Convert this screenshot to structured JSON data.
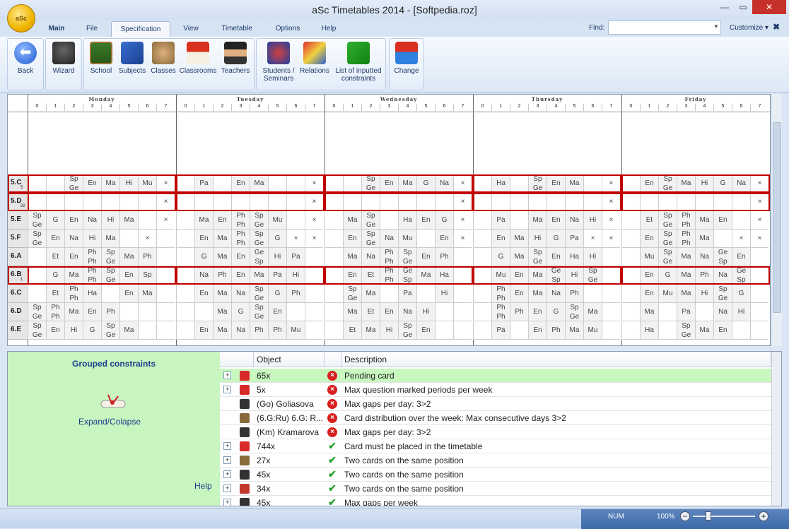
{
  "window": {
    "title": "aSc Timetables 2014  - [Softpedia.roz]",
    "minimize": "—",
    "maximize": "▭",
    "close": "✕",
    "orb": "aSc"
  },
  "tabs": [
    "Main",
    "File",
    "Specification",
    "View",
    "Timetable",
    "Options",
    "Help"
  ],
  "find": {
    "label": "Find:",
    "value": ""
  },
  "customize": "Customize ▾",
  "close_x": "✖",
  "ribbon": {
    "back": "Back",
    "wizard": "Wizard",
    "school": "School",
    "subjects": "Subjects",
    "classes": "Classes",
    "classrooms": "Classrooms",
    "teachers": "Teachers",
    "students_1": "Students /",
    "students_2": "Seminars",
    "relations": "Relations",
    "list_1": "List of inputted",
    "list_2": "constraints",
    "change": "Change"
  },
  "days": [
    "Monday",
    "Tuesday",
    "Wednesday",
    "Thursday",
    "Friday"
  ],
  "periods": [
    "0",
    "1",
    "2",
    "3",
    "4",
    "5",
    "6",
    "7"
  ],
  "rows": [
    {
      "name": "5.C",
      "sub": "5",
      "cells": [
        [
          "",
          "",
          "Sp|Ge",
          "En",
          "Ma",
          "Hi",
          "Mu",
          "×"
        ],
        [
          "",
          "Pa",
          "",
          "En",
          "Ma",
          "",
          "",
          "×"
        ],
        [
          "",
          "",
          "Sp|Ge",
          "En",
          "Ma",
          "G",
          "Na",
          "×"
        ],
        [
          "",
          "Ha",
          "",
          "Sp|Ge",
          "En",
          "Ma",
          "",
          "×"
        ],
        [
          "",
          "En",
          "Sp|Ge",
          "Ma",
          "Hi",
          "G",
          "Na",
          "×"
        ]
      ]
    },
    {
      "name": "5.D",
      "sub": "32",
      "cells": [
        [
          "",
          "",
          "",
          "",
          "",
          "",
          "",
          "×"
        ],
        [
          "",
          "",
          "",
          "",
          "",
          "",
          "",
          "×"
        ],
        [
          "",
          "",
          "",
          "",
          "",
          "",
          "",
          "×"
        ],
        [
          "",
          "",
          "",
          "",
          "",
          "",
          "",
          "×"
        ],
        [
          "",
          "",
          "",
          "",
          "",
          "",
          "",
          "×"
        ]
      ]
    },
    {
      "name": "5.E",
      "sub": "",
      "cells": [
        [
          "Sp|Ge",
          "G",
          "En",
          "Na",
          "Hi",
          "Ma",
          "",
          "×"
        ],
        [
          "",
          "Ma",
          "En",
          "Ph|Ph",
          "Sp|Ge",
          "Mu",
          "",
          "×"
        ],
        [
          "",
          "Ma",
          "Sp|Ge",
          "",
          "Ha",
          "En",
          "G",
          "×"
        ],
        [
          "",
          "Pa",
          "",
          "Ma",
          "En",
          "Na",
          "Hi",
          "×"
        ],
        [
          "",
          "Et",
          "Sp|Ge",
          "Ph|Ph",
          "Ma",
          "En",
          "",
          "×"
        ]
      ]
    },
    {
      "name": "5.F",
      "sub": "",
      "cells": [
        [
          "Sp|Ge",
          "En",
          "Na",
          "Hi",
          "Ma",
          "",
          "×",
          ""
        ],
        [
          "",
          "En",
          "Ma",
          "Ph|Ph",
          "Sp|Ge",
          "G",
          "×",
          "×"
        ],
        [
          "",
          "En",
          "Sp|Ge",
          "Na",
          "Mu",
          "",
          "En",
          "×"
        ],
        [
          "",
          "En",
          "Ma",
          "Hi",
          "G",
          "Pa",
          "×",
          "×"
        ],
        [
          "",
          "En",
          "Sp|Ge",
          "Ph|Ph",
          "Ma",
          "",
          "×",
          "×"
        ]
      ]
    },
    {
      "name": "6.A",
      "sub": "",
      "cells": [
        [
          "",
          "Et",
          "En",
          "Ph|Ph",
          "Sp|Ge",
          "Ma",
          "Ph",
          ""
        ],
        [
          "",
          "G",
          "Ma",
          "En",
          "Ge|Sp",
          "Hi",
          "Pa",
          ""
        ],
        [
          "",
          "Ma",
          "Na",
          "Ph|Ph",
          "Sp|Ge",
          "En",
          "Ph",
          ""
        ],
        [
          "",
          "G",
          "Ma",
          "Sp|Ge",
          "En",
          "Ha",
          "Hi",
          ""
        ],
        [
          "",
          "Mu",
          "Sp|Ge",
          "Ma",
          "Na",
          "Ge|Sp",
          "En",
          ""
        ]
      ]
    },
    {
      "name": "6.B",
      "sub": "1",
      "cells": [
        [
          "",
          "G",
          "Ma",
          "Ph|Ph",
          "Sp|Ge",
          "En",
          "Sp",
          ""
        ],
        [
          "",
          "Na",
          "Ph",
          "En",
          "Ma",
          "Pa",
          "Hi",
          ""
        ],
        [
          "",
          "En",
          "Et",
          "Ph|Ph",
          "Ge|Sp",
          "Ma",
          "Ha",
          ""
        ],
        [
          "",
          "Mu",
          "En",
          "Ma",
          "Ge|Sp",
          "Hi",
          "Sp|Ge",
          ""
        ],
        [
          "",
          "En",
          "G",
          "Ma",
          "Ph",
          "Na",
          "Ge|Sp",
          ""
        ]
      ]
    },
    {
      "name": "6.C",
      "sub": "",
      "cells": [
        [
          "",
          "Et",
          "Ph|Ph",
          "Ha",
          "",
          "En",
          "Ma",
          ""
        ],
        [
          "",
          "En",
          "Ma",
          "Na",
          "Sp|Ge",
          "G",
          "Ph",
          ""
        ],
        [
          "",
          "Sp|Ge",
          "Ma",
          "",
          "Pa",
          "",
          "Hi",
          ""
        ],
        [
          "",
          "Ph|Ph",
          "En",
          "Ma",
          "Na",
          "Ph",
          "",
          ""
        ],
        [
          "",
          "En",
          "Mu",
          "Ma",
          "Hi",
          "Sp|Ge",
          "G",
          ""
        ]
      ]
    },
    {
      "name": "6.D",
      "sub": "",
      "cells": [
        [
          "Sp|Ge",
          "Ph|Ph",
          "Ma",
          "En",
          "Ph",
          "",
          "",
          " "
        ],
        [
          "",
          "",
          "Ma",
          "G",
          "Sp|Ge",
          "En",
          "",
          ""
        ],
        [
          "",
          "Ma",
          "Et",
          "En",
          "Na",
          "Hi",
          "",
          ""
        ],
        [
          "",
          "Ph|Ph",
          "Ph",
          "En",
          "G",
          "Sp|Ge",
          "Ma",
          ""
        ],
        [
          "",
          "Ma",
          "",
          "Pa",
          "",
          "Na",
          "Hi",
          ""
        ]
      ]
    },
    {
      "name": "6.E",
      "sub": "",
      "cells": [
        [
          "Sp|Ge",
          "En",
          "Hi",
          "G",
          "Sp|Ge",
          "Ma",
          "",
          ""
        ],
        [
          "",
          "En",
          "Ma",
          "Na",
          "Ph",
          "Ph",
          "Mu",
          ""
        ],
        [
          "",
          "Et",
          "Ma",
          "Hi",
          "Sp|Ge",
          "En",
          "",
          ""
        ],
        [
          "",
          "Pa",
          "",
          "En",
          "Ph",
          "Ma",
          "Mu",
          ""
        ],
        [
          "",
          "Ha",
          "",
          "Sp|Ge",
          "Ma",
          "En",
          "",
          ""
        ]
      ]
    }
  ],
  "grouped": {
    "title": "Grouped constraints",
    "expand": "Expand/Colapse",
    "help": "Help"
  },
  "table": {
    "headers": [
      "Object",
      "Description"
    ],
    "rows": [
      {
        "exp": "+",
        "icon": "class-icon",
        "icon_color": "#d92a2a",
        "object": "65x",
        "status": "err",
        "desc": "Pending card",
        "hl": true
      },
      {
        "exp": "+",
        "icon": "class-icon",
        "icon_color": "#d92a2a",
        "object": "5x",
        "status": "err",
        "desc": "Max question marked periods per week",
        "hl": false
      },
      {
        "exp": "",
        "icon": "teacher-icon",
        "icon_color": "#333333",
        "object": "(Go) Goliasova",
        "status": "err",
        "desc": "Max gaps per day: 3>2",
        "hl": false
      },
      {
        "exp": "",
        "icon": "students-icon",
        "icon_color": "#8a6a3a",
        "object": "(6.G:Ru) 6.G: R...",
        "status": "err",
        "desc": "Card distribution over the week: Max consecutive days 3>2",
        "hl": false
      },
      {
        "exp": "",
        "icon": "teacher-icon",
        "icon_color": "#333333",
        "object": "(Km) Kramarova",
        "status": "err",
        "desc": "Max gaps per day: 3>2",
        "hl": false
      },
      {
        "exp": "+",
        "icon": "class-icon",
        "icon_color": "#d92a2a",
        "object": "744x",
        "status": "ok",
        "desc": "Card must be placed in the timetable",
        "hl": false
      },
      {
        "exp": "+",
        "icon": "students-icon",
        "icon_color": "#8a6a3a",
        "object": "27x",
        "status": "ok",
        "desc": "Two cards on the same position",
        "hl": false
      },
      {
        "exp": "+",
        "icon": "teacher-icon",
        "icon_color": "#333333",
        "object": "45x",
        "status": "ok",
        "desc": "Two cards on the same position",
        "hl": false
      },
      {
        "exp": "+",
        "icon": "classroom-icon",
        "icon_color": "#c0392b",
        "object": "34x",
        "status": "ok",
        "desc": "Two cards on the same position",
        "hl": false
      },
      {
        "exp": "+",
        "icon": "teacher-icon",
        "icon_color": "#333333",
        "object": "45x",
        "status": "ok",
        "desc": "Max gaps per week",
        "hl": false
      }
    ]
  },
  "status": {
    "num": "NUM",
    "zoom": "100%",
    "minus": "−",
    "plus": "+"
  }
}
